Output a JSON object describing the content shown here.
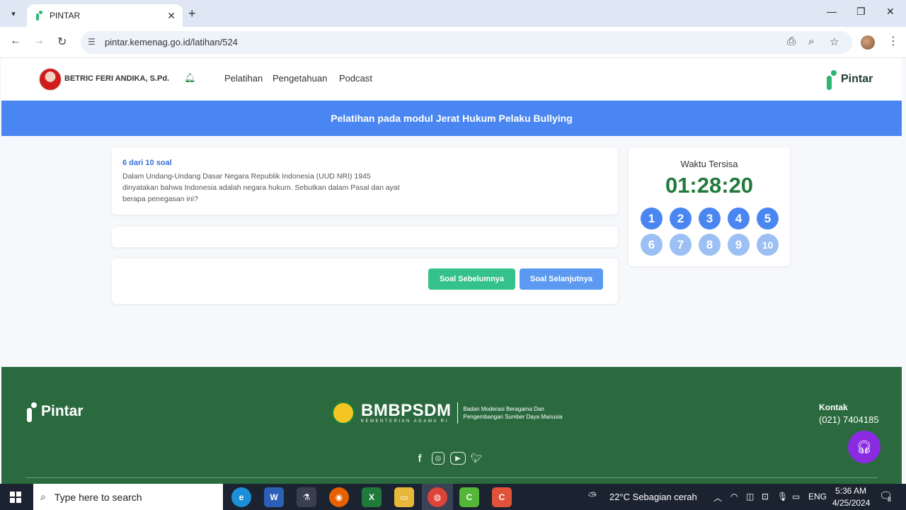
{
  "browser": {
    "tab_title": "PINTAR",
    "url": "pintar.kemenag.go.id/latihan/524"
  },
  "header": {
    "user_name": "BETRIC FERI ANDIKA, S.Pd.",
    "nav": [
      "Pelatihan",
      "Pengetahuan",
      "Podcast"
    ],
    "logo_text": "Pintar"
  },
  "banner": {
    "title": "Pelatihan pada modul Jerat Hukum Pelaku Bullying"
  },
  "question": {
    "counter": "6 dari 10 soal",
    "lines": [
      "Dalam Undang-Undang Dasar Negara Republik Indonesia (UUD NRI) 1945",
      "dinyatakan bahwa Indonesia adalah negara hukum. Sebutkan dalam Pasal dan ayat",
      "berapa penegasan ini?"
    ]
  },
  "actions": {
    "prev": "Soal Sebelumnya",
    "next": "Soal Selanjutnya"
  },
  "timer": {
    "label": "Waktu Tersisa",
    "value": "01:28:20"
  },
  "question_numbers": [
    "1",
    "2",
    "3",
    "4",
    "5",
    "6",
    "7",
    "8",
    "9",
    "10"
  ],
  "footer": {
    "logo_text": "Pintar",
    "org_title": "BMBPSDM",
    "org_sub": "KEMENTERIAN AGAMA RI",
    "org_desc_1": "Badan Moderasi Beragama Dan",
    "org_desc_2": "Pengembangan Sumber Daya Manusia",
    "contact_label": "Kontak",
    "contact_phone": "(021) 7404185"
  },
  "taskbar": {
    "search_placeholder": "Type here to search",
    "weather": "22°C  Sebagian cerah",
    "lang": "ENG",
    "time": "5:36 AM",
    "date": "4/25/2024",
    "notifications": "3"
  },
  "colors": {
    "banner": "#4a86f1",
    "footer": "#2a6a3e",
    "timer": "#1f7a3b",
    "btn_prev": "#35c28a",
    "btn_next": "#5b9af0"
  }
}
